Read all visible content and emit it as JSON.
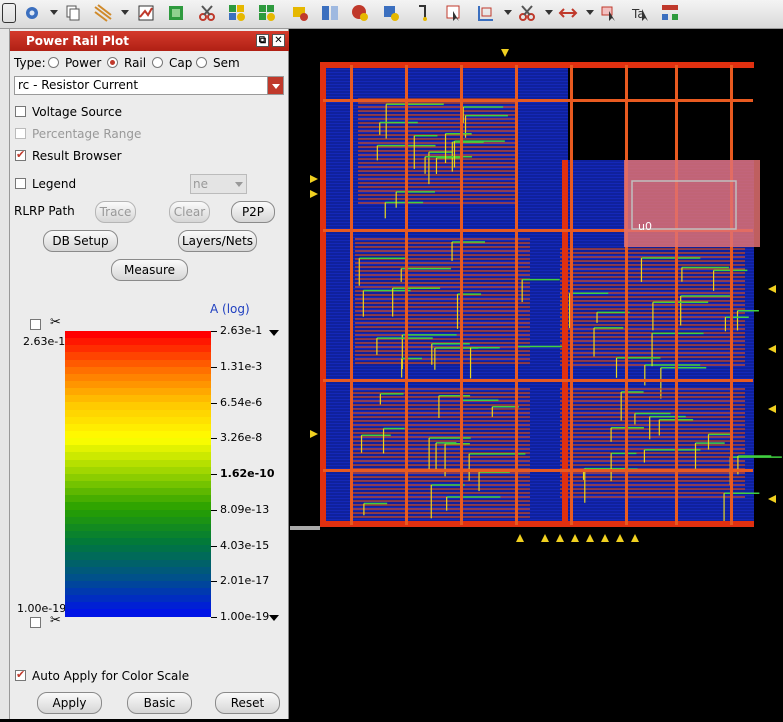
{
  "toolbar": {
    "icons": [
      "app-menu-icon",
      "gear-icon",
      "copy-icon",
      "wires-icon",
      "plot-icon",
      "layers-icon",
      "cut-icon",
      "add-cells-icon",
      "add-cells-2-icon",
      "highlight-icon",
      "compare-icon",
      "stop-icon",
      "probe-icon",
      "route-icon",
      "select-icon",
      "zoom-box-icon",
      "cut-2-icon",
      "flip-icon",
      "pointer-icon",
      "pointer-text-icon",
      "hierarchy-icon"
    ]
  },
  "panel": {
    "title": "Power Rail Plot",
    "type_label": "Type:",
    "type_options": [
      "Power",
      "Rail",
      "Cap",
      "Sem"
    ],
    "type_selected": "Rail",
    "dropdown_value": "rc - Resistor Current",
    "voltage_source": "Voltage Source",
    "percentage_range": "Percentage Range",
    "result_browser": "Result Browser",
    "legend": "Legend",
    "legend_combo": "ne",
    "rlrp_label": "RLRP Path",
    "trace": "Trace",
    "clear": "Clear",
    "p2p": "P2P",
    "db_setup": "DB Setup",
    "layers_nets": "Layers/Nets",
    "measure": "Measure",
    "units": "A  (log)",
    "scale_top_left": "2.63e-1",
    "scale_bottom_left": "1.00e-19",
    "ticks": [
      "2.63e-1",
      "1.31e-3",
      "6.54e-6",
      "3.26e-8",
      "1.62e-10",
      "8.09e-13",
      "4.03e-15",
      "2.01e-17",
      "1.00e-19"
    ],
    "bold_tick": "1.62e-10",
    "auto_apply": "Auto Apply for Color Scale",
    "apply": "Apply",
    "basic": "Basic",
    "reset": "Reset"
  },
  "layout_view": {
    "instance_label": "u0"
  },
  "colors": {
    "title_bar": "#c0392b",
    "accent": "#c0392b"
  }
}
